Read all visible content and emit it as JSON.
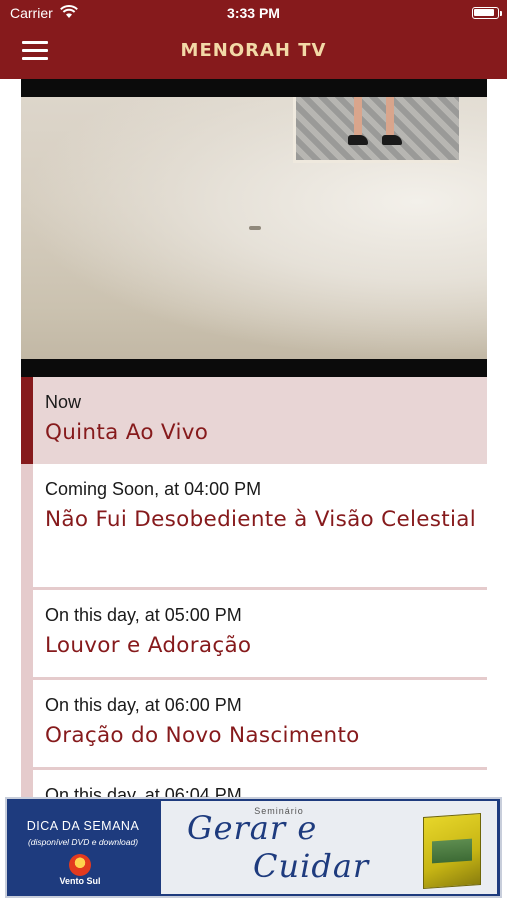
{
  "status_bar": {
    "carrier": "Carrier",
    "time": "3:33 PM"
  },
  "nav": {
    "title": "MENORAH TV",
    "menu_icon": "hamburger-icon"
  },
  "player": {
    "state": "playing"
  },
  "schedule": {
    "current": {
      "when": "Now",
      "title": "Quinta Ao Vivo"
    },
    "items": [
      {
        "when": "Coming Soon, at 04:00 PM",
        "title": "Não Fui Desobediente à Visão Celestial"
      },
      {
        "when": "On this day, at 05:00 PM",
        "title": "Louvor e Adoração"
      },
      {
        "when": "On this day, at 06:00 PM",
        "title": "Oração do Novo Nascimento"
      },
      {
        "when": "On this day, at 06:04 PM",
        "title": ""
      }
    ]
  },
  "ad": {
    "dica": "DICA DA SEMANA",
    "dica_sub": "(disponível DVD e download)",
    "brand": "Vento Sul",
    "seminario": "Seminário",
    "title_line1": "Gerar e",
    "title_line2": "Cuidar"
  },
  "colors": {
    "brand": "#861a1c",
    "nav_title": "#f3d9a7",
    "current_row_bg": "#e8d5d5",
    "rail": "#e5cbcc",
    "ad_blue": "#1e3b7e"
  }
}
